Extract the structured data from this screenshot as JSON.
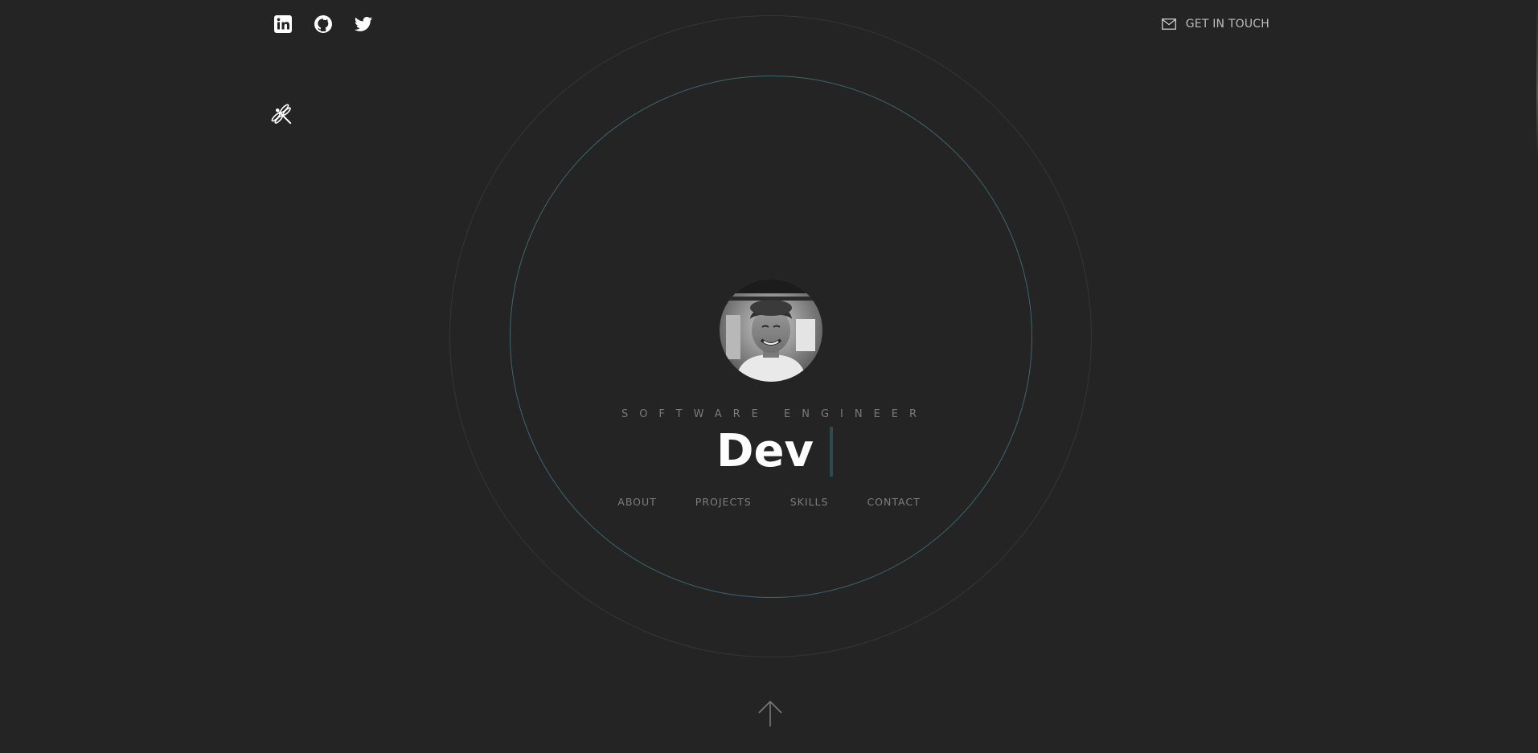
{
  "social": {
    "linkedin_icon": "linkedin-icon",
    "github_icon": "github-icon",
    "twitter_icon": "twitter-icon"
  },
  "header": {
    "contact_label": "GET IN TOUCH",
    "contact_icon": "mail-icon"
  },
  "logo": {
    "icon": "dragonfly-icon"
  },
  "hero": {
    "role": "SOFTWARE ENGINEER",
    "name": "Dev"
  },
  "nav": {
    "items": [
      {
        "label": "ABOUT"
      },
      {
        "label": "PROJECTS"
      },
      {
        "label": "SKILLS"
      },
      {
        "label": "CONTACT"
      }
    ]
  },
  "footer": {
    "scroll_icon": "arrow-up-icon"
  },
  "colors": {
    "background": "#242424",
    "inner_ring": "#3e6670",
    "outer_ring": "#363636",
    "text_muted": "#7e7e7e",
    "text_primary": "#ffffff"
  }
}
